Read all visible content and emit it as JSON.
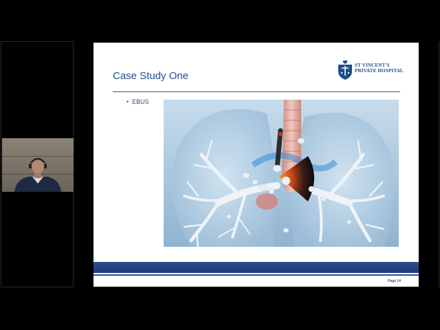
{
  "slide": {
    "title": "Case Study One",
    "bullet": "EBUS",
    "page_label": "Page 14",
    "logo": {
      "line1": "ST VINCENT'S",
      "line2": "PRIVATE HOSPITAL"
    }
  },
  "colors": {
    "title_blue": "#1f4e8c",
    "band_blue": "#2e4d8e",
    "background": "#000000"
  },
  "icons": {
    "hospital_crest": "crest-icon",
    "bullet": "bullet-dot"
  }
}
